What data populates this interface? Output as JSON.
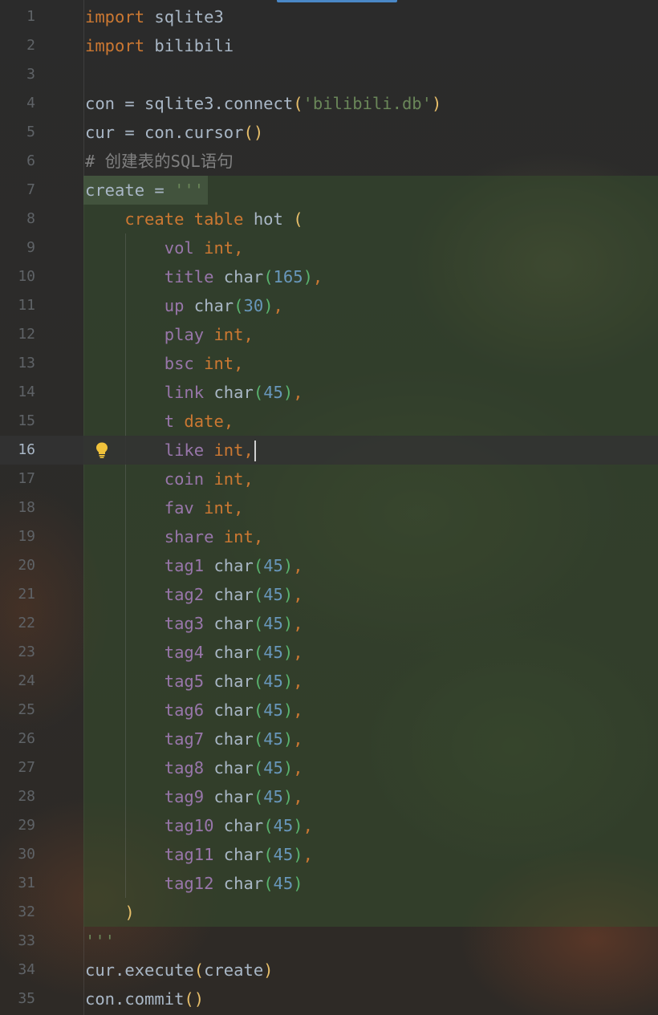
{
  "editor": {
    "current_line": 16,
    "lines": [
      {
        "n": "1",
        "tokens": [
          {
            "t": "import",
            "c": "kw"
          },
          {
            "t": " sqlite3",
            "c": "pl"
          }
        ]
      },
      {
        "n": "2",
        "tokens": [
          {
            "t": "import",
            "c": "kw"
          },
          {
            "t": " bilibili",
            "c": "pl"
          }
        ]
      },
      {
        "n": "3",
        "tokens": []
      },
      {
        "n": "4",
        "tokens": [
          {
            "t": "con = sqlite3.connect",
            "c": "pl"
          },
          {
            "t": "(",
            "c": "p1"
          },
          {
            "t": "'bilibili.db'",
            "c": "str"
          },
          {
            "t": ")",
            "c": "p1"
          }
        ]
      },
      {
        "n": "5",
        "tokens": [
          {
            "t": "cur = con.cursor",
            "c": "pl"
          },
          {
            "t": "()",
            "c": "p1"
          }
        ]
      },
      {
        "n": "6",
        "tokens": [
          {
            "t": "# 创建表的SQL语句",
            "c": "cmt"
          }
        ]
      },
      {
        "n": "7",
        "tokens": [
          {
            "t": "create = ",
            "c": "pl"
          },
          {
            "t": "'''",
            "c": "str"
          }
        ]
      },
      {
        "n": "8",
        "tokens": [
          {
            "t": "    ",
            "c": "pl"
          },
          {
            "t": "create table",
            "c": "kw"
          },
          {
            "t": " hot ",
            "c": "pl"
          },
          {
            "t": "(",
            "c": "p1"
          }
        ]
      },
      {
        "n": "9",
        "tokens": [
          {
            "t": "        ",
            "c": "pl"
          },
          {
            "t": "vol",
            "c": "fld"
          },
          {
            "t": " int",
            "c": "kw"
          },
          {
            "t": ",",
            "c": "kw"
          }
        ]
      },
      {
        "n": "10",
        "tokens": [
          {
            "t": "        ",
            "c": "pl"
          },
          {
            "t": "title",
            "c": "fld"
          },
          {
            "t": " char",
            "c": "pl"
          },
          {
            "t": "(",
            "c": "p2"
          },
          {
            "t": "165",
            "c": "num"
          },
          {
            "t": ")",
            "c": "p2"
          },
          {
            "t": ",",
            "c": "kw"
          }
        ]
      },
      {
        "n": "11",
        "tokens": [
          {
            "t": "        ",
            "c": "pl"
          },
          {
            "t": "up",
            "c": "fld"
          },
          {
            "t": " char",
            "c": "pl"
          },
          {
            "t": "(",
            "c": "p2"
          },
          {
            "t": "30",
            "c": "num"
          },
          {
            "t": ")",
            "c": "p2"
          },
          {
            "t": ",",
            "c": "kw"
          }
        ]
      },
      {
        "n": "12",
        "tokens": [
          {
            "t": "        ",
            "c": "pl"
          },
          {
            "t": "play",
            "c": "fld"
          },
          {
            "t": " int",
            "c": "kw"
          },
          {
            "t": ",",
            "c": "kw"
          }
        ]
      },
      {
        "n": "13",
        "tokens": [
          {
            "t": "        ",
            "c": "pl"
          },
          {
            "t": "bsc",
            "c": "fld"
          },
          {
            "t": " int",
            "c": "kw"
          },
          {
            "t": ",",
            "c": "kw"
          }
        ]
      },
      {
        "n": "14",
        "tokens": [
          {
            "t": "        ",
            "c": "pl"
          },
          {
            "t": "link",
            "c": "fld"
          },
          {
            "t": " char",
            "c": "pl"
          },
          {
            "t": "(",
            "c": "p2"
          },
          {
            "t": "45",
            "c": "num"
          },
          {
            "t": ")",
            "c": "p2"
          },
          {
            "t": ",",
            "c": "kw"
          }
        ]
      },
      {
        "n": "15",
        "tokens": [
          {
            "t": "        ",
            "c": "pl"
          },
          {
            "t": "t",
            "c": "fld"
          },
          {
            "t": " date",
            "c": "kw"
          },
          {
            "t": ",",
            "c": "kw"
          }
        ]
      },
      {
        "n": "16",
        "tokens": [
          {
            "t": "        ",
            "c": "pl"
          },
          {
            "t": "like",
            "c": "fld"
          },
          {
            "t": " int",
            "c": "kw"
          },
          {
            "t": ",",
            "c": "kw"
          }
        ],
        "caret": true
      },
      {
        "n": "17",
        "tokens": [
          {
            "t": "        ",
            "c": "pl"
          },
          {
            "t": "coin",
            "c": "fld"
          },
          {
            "t": " int",
            "c": "kw"
          },
          {
            "t": ",",
            "c": "kw"
          }
        ]
      },
      {
        "n": "18",
        "tokens": [
          {
            "t": "        ",
            "c": "pl"
          },
          {
            "t": "fav",
            "c": "fld"
          },
          {
            "t": " int",
            "c": "kw"
          },
          {
            "t": ",",
            "c": "kw"
          }
        ]
      },
      {
        "n": "19",
        "tokens": [
          {
            "t": "        ",
            "c": "pl"
          },
          {
            "t": "share",
            "c": "fld"
          },
          {
            "t": " int",
            "c": "kw"
          },
          {
            "t": ",",
            "c": "kw"
          }
        ]
      },
      {
        "n": "20",
        "tokens": [
          {
            "t": "        ",
            "c": "pl"
          },
          {
            "t": "tag1",
            "c": "fld"
          },
          {
            "t": " char",
            "c": "pl"
          },
          {
            "t": "(",
            "c": "p2"
          },
          {
            "t": "45",
            "c": "num"
          },
          {
            "t": ")",
            "c": "p2"
          },
          {
            "t": ",",
            "c": "kw"
          }
        ]
      },
      {
        "n": "21",
        "tokens": [
          {
            "t": "        ",
            "c": "pl"
          },
          {
            "t": "tag2",
            "c": "fld"
          },
          {
            "t": " char",
            "c": "pl"
          },
          {
            "t": "(",
            "c": "p2"
          },
          {
            "t": "45",
            "c": "num"
          },
          {
            "t": ")",
            "c": "p2"
          },
          {
            "t": ",",
            "c": "kw"
          }
        ]
      },
      {
        "n": "22",
        "tokens": [
          {
            "t": "        ",
            "c": "pl"
          },
          {
            "t": "tag3",
            "c": "fld"
          },
          {
            "t": " char",
            "c": "pl"
          },
          {
            "t": "(",
            "c": "p2"
          },
          {
            "t": "45",
            "c": "num"
          },
          {
            "t": ")",
            "c": "p2"
          },
          {
            "t": ",",
            "c": "kw"
          }
        ]
      },
      {
        "n": "23",
        "tokens": [
          {
            "t": "        ",
            "c": "pl"
          },
          {
            "t": "tag4",
            "c": "fld"
          },
          {
            "t": " char",
            "c": "pl"
          },
          {
            "t": "(",
            "c": "p2"
          },
          {
            "t": "45",
            "c": "num"
          },
          {
            "t": ")",
            "c": "p2"
          },
          {
            "t": ",",
            "c": "kw"
          }
        ]
      },
      {
        "n": "24",
        "tokens": [
          {
            "t": "        ",
            "c": "pl"
          },
          {
            "t": "tag5",
            "c": "fld"
          },
          {
            "t": " char",
            "c": "pl"
          },
          {
            "t": "(",
            "c": "p2"
          },
          {
            "t": "45",
            "c": "num"
          },
          {
            "t": ")",
            "c": "p2"
          },
          {
            "t": ",",
            "c": "kw"
          }
        ]
      },
      {
        "n": "25",
        "tokens": [
          {
            "t": "        ",
            "c": "pl"
          },
          {
            "t": "tag6",
            "c": "fld"
          },
          {
            "t": " char",
            "c": "pl"
          },
          {
            "t": "(",
            "c": "p2"
          },
          {
            "t": "45",
            "c": "num"
          },
          {
            "t": ")",
            "c": "p2"
          },
          {
            "t": ",",
            "c": "kw"
          }
        ]
      },
      {
        "n": "26",
        "tokens": [
          {
            "t": "        ",
            "c": "pl"
          },
          {
            "t": "tag7",
            "c": "fld"
          },
          {
            "t": " char",
            "c": "pl"
          },
          {
            "t": "(",
            "c": "p2"
          },
          {
            "t": "45",
            "c": "num"
          },
          {
            "t": ")",
            "c": "p2"
          },
          {
            "t": ",",
            "c": "kw"
          }
        ]
      },
      {
        "n": "27",
        "tokens": [
          {
            "t": "        ",
            "c": "pl"
          },
          {
            "t": "tag8",
            "c": "fld"
          },
          {
            "t": " char",
            "c": "pl"
          },
          {
            "t": "(",
            "c": "p2"
          },
          {
            "t": "45",
            "c": "num"
          },
          {
            "t": ")",
            "c": "p2"
          },
          {
            "t": ",",
            "c": "kw"
          }
        ]
      },
      {
        "n": "28",
        "tokens": [
          {
            "t": "        ",
            "c": "pl"
          },
          {
            "t": "tag9",
            "c": "fld"
          },
          {
            "t": " char",
            "c": "pl"
          },
          {
            "t": "(",
            "c": "p2"
          },
          {
            "t": "45",
            "c": "num"
          },
          {
            "t": ")",
            "c": "p2"
          },
          {
            "t": ",",
            "c": "kw"
          }
        ]
      },
      {
        "n": "29",
        "tokens": [
          {
            "t": "        ",
            "c": "pl"
          },
          {
            "t": "tag10",
            "c": "fld"
          },
          {
            "t": " char",
            "c": "pl"
          },
          {
            "t": "(",
            "c": "p2"
          },
          {
            "t": "45",
            "c": "num"
          },
          {
            "t": ")",
            "c": "p2"
          },
          {
            "t": ",",
            "c": "kw"
          }
        ]
      },
      {
        "n": "30",
        "tokens": [
          {
            "t": "        ",
            "c": "pl"
          },
          {
            "t": "tag11",
            "c": "fld"
          },
          {
            "t": " char",
            "c": "pl"
          },
          {
            "t": "(",
            "c": "p2"
          },
          {
            "t": "45",
            "c": "num"
          },
          {
            "t": ")",
            "c": "p2"
          },
          {
            "t": ",",
            "c": "kw"
          }
        ]
      },
      {
        "n": "31",
        "tokens": [
          {
            "t": "        ",
            "c": "pl"
          },
          {
            "t": "tag12",
            "c": "fld"
          },
          {
            "t": " char",
            "c": "pl"
          },
          {
            "t": "(",
            "c": "p2"
          },
          {
            "t": "45",
            "c": "num"
          },
          {
            "t": ")",
            "c": "p2"
          }
        ]
      },
      {
        "n": "32",
        "tokens": [
          {
            "t": "    ",
            "c": "pl"
          },
          {
            "t": ")",
            "c": "p1"
          }
        ]
      },
      {
        "n": "33",
        "tokens": [
          {
            "t": "'''",
            "c": "str"
          }
        ]
      },
      {
        "n": "34",
        "tokens": [
          {
            "t": "cur.execute",
            "c": "pl"
          },
          {
            "t": "(",
            "c": "p1"
          },
          {
            "t": "create",
            "c": "pl"
          },
          {
            "t": ")",
            "c": "p1"
          }
        ]
      },
      {
        "n": "35",
        "tokens": [
          {
            "t": "con.commit",
            "c": "pl"
          },
          {
            "t": "()",
            "c": "p1"
          }
        ]
      }
    ]
  },
  "icons": {
    "intention_bulb": "lightbulb-icon",
    "bulb_color": "#f0c23b"
  }
}
